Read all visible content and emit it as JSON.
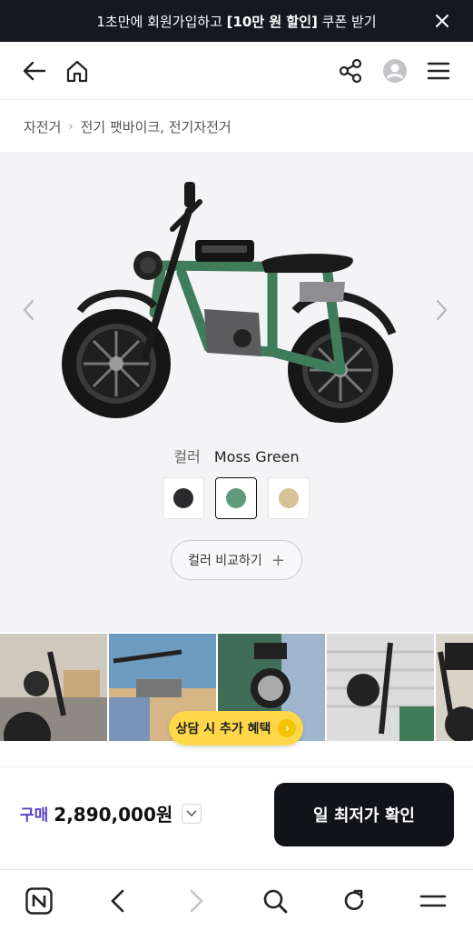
{
  "promo": {
    "text_before": "1초만에 회원가입하고 ",
    "text_strong": "[10만 원 할인]",
    "text_after": " 쿠폰 받기"
  },
  "nav": {
    "icons": [
      "back-arrow-icon",
      "home-icon",
      "share-icon",
      "account-icon",
      "menu-icon"
    ]
  },
  "breadcrumb": {
    "root": "자전거",
    "current": "전기 팻바이크, 전기자전거"
  },
  "product": {
    "color_label": "컬러",
    "color_value": "Moss Green",
    "swatches": [
      {
        "name": "Black",
        "color": "#2a2a2c"
      },
      {
        "name": "Moss Green",
        "color": "#5f9a7a"
      },
      {
        "name": "Sand",
        "color": "#d7c293"
      }
    ],
    "compare_label": "컬러 비교하기",
    "compare_plus": "+"
  },
  "consult": {
    "label": "상담 시 추가 혜택",
    "chevron": "›"
  },
  "purchase": {
    "buy_label": "구매",
    "price": "2,890,000원",
    "cta_label": "일 최저가 확인"
  },
  "bottom_nav": {
    "icons": [
      "naver-n-icon",
      "browser-back-icon",
      "browser-forward-icon",
      "search-icon",
      "reload-icon",
      "menu-icon"
    ]
  },
  "colors": {
    "accent": "#5a3ec8",
    "cta_bg": "#111318",
    "promo_bg": "#141920",
    "consult_bg": "#ffd84a",
    "bike_frame": "#3f7d5a"
  }
}
